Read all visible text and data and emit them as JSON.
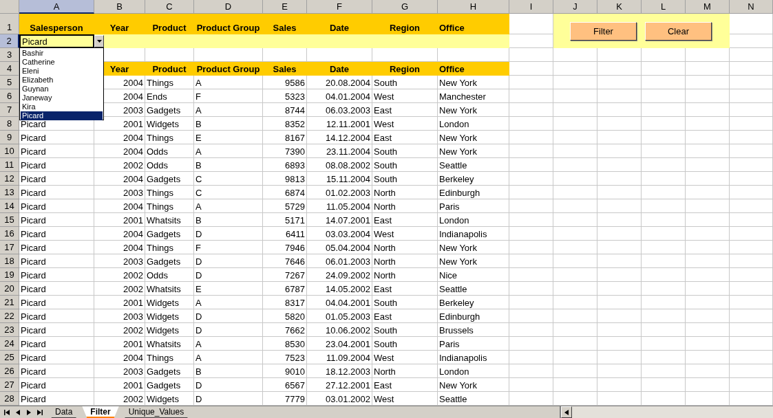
{
  "columns": [
    {
      "label": "A",
      "selected": true
    },
    {
      "label": "B",
      "selected": false
    },
    {
      "label": "C",
      "selected": false
    },
    {
      "label": "D",
      "selected": false
    },
    {
      "label": "E",
      "selected": false
    },
    {
      "label": "F",
      "selected": false
    },
    {
      "label": "G",
      "selected": false
    },
    {
      "label": "H",
      "selected": false
    },
    {
      "label": "I",
      "selected": false
    },
    {
      "label": "J",
      "selected": false
    },
    {
      "label": "K",
      "selected": false
    },
    {
      "label": "L",
      "selected": false
    },
    {
      "label": "M",
      "selected": false
    },
    {
      "label": "N",
      "selected": false
    }
  ],
  "row_numbers": [
    {
      "label": "1",
      "selected": false
    },
    {
      "label": "2",
      "selected": true
    },
    {
      "label": "3",
      "selected": false
    },
    {
      "label": "4",
      "selected": false
    },
    {
      "label": "5",
      "selected": false
    },
    {
      "label": "6",
      "selected": false
    },
    {
      "label": "7",
      "selected": false
    },
    {
      "label": "8",
      "selected": false
    },
    {
      "label": "9",
      "selected": false
    },
    {
      "label": "10",
      "selected": false
    },
    {
      "label": "11",
      "selected": false
    },
    {
      "label": "12",
      "selected": false
    },
    {
      "label": "13",
      "selected": false
    },
    {
      "label": "14",
      "selected": false
    },
    {
      "label": "15",
      "selected": false
    },
    {
      "label": "16",
      "selected": false
    },
    {
      "label": "17",
      "selected": false
    },
    {
      "label": "18",
      "selected": false
    },
    {
      "label": "19",
      "selected": false
    },
    {
      "label": "20",
      "selected": false
    },
    {
      "label": "21",
      "selected": false
    },
    {
      "label": "22",
      "selected": false
    },
    {
      "label": "23",
      "selected": false
    },
    {
      "label": "24",
      "selected": false
    },
    {
      "label": "25",
      "selected": false
    },
    {
      "label": "26",
      "selected": false
    },
    {
      "label": "27",
      "selected": false
    },
    {
      "label": "28",
      "selected": false
    }
  ],
  "criteria_header": [
    "Salesperson",
    "Year",
    "Product",
    "Product Group",
    "Sales",
    "Date",
    "Region",
    "Office"
  ],
  "criteria_value": "Picard",
  "dropdown": [
    {
      "label": "Bashir",
      "selected": false
    },
    {
      "label": "Catherine",
      "selected": false
    },
    {
      "label": "Eleni",
      "selected": false
    },
    {
      "label": "Elizabeth",
      "selected": false
    },
    {
      "label": "Guynan",
      "selected": false
    },
    {
      "label": "Janeway",
      "selected": false
    },
    {
      "label": "Kira",
      "selected": false
    },
    {
      "label": "Picard",
      "selected": true
    }
  ],
  "buttons": [
    "Filter",
    "Clear"
  ],
  "result_header": [
    "Year",
    "Product",
    "Product Group",
    "Sales",
    "Date",
    "Region",
    "Office"
  ],
  "data_rows": [
    {
      "values": [
        "2004",
        "Things",
        "A",
        "9586",
        "20.08.2004",
        "South",
        "New York"
      ]
    },
    {
      "values": [
        "2004",
        "Ends",
        "F",
        "5323",
        "04.01.2004",
        "West",
        "Manchester"
      ]
    },
    {
      "values": [
        "2003",
        "Gadgets",
        "A",
        "8744",
        "06.03.2003",
        "East",
        "New York"
      ]
    },
    {
      "salesperson": "Picard",
      "values": [
        "2001",
        "Widgets",
        "B",
        "8352",
        "12.11.2001",
        "West",
        "London"
      ]
    },
    {
      "salesperson": "Picard",
      "values": [
        "2004",
        "Things",
        "E",
        "8167",
        "14.12.2004",
        "East",
        "New York"
      ]
    },
    {
      "salesperson": "Picard",
      "values": [
        "2004",
        "Odds",
        "A",
        "7390",
        "23.11.2004",
        "South",
        "New York"
      ]
    },
    {
      "salesperson": "Picard",
      "values": [
        "2002",
        "Odds",
        "B",
        "6893",
        "08.08.2002",
        "South",
        "Seattle"
      ]
    },
    {
      "salesperson": "Picard",
      "values": [
        "2004",
        "Gadgets",
        "C",
        "9813",
        "15.11.2004",
        "South",
        "Berkeley"
      ]
    },
    {
      "salesperson": "Picard",
      "values": [
        "2003",
        "Things",
        "C",
        "6874",
        "01.02.2003",
        "North",
        "Edinburgh"
      ]
    },
    {
      "salesperson": "Picard",
      "values": [
        "2004",
        "Things",
        "A",
        "5729",
        "11.05.2004",
        "North",
        "Paris"
      ]
    },
    {
      "salesperson": "Picard",
      "values": [
        "2001",
        "Whatsits",
        "B",
        "5171",
        "14.07.2001",
        "East",
        "London"
      ]
    },
    {
      "salesperson": "Picard",
      "values": [
        "2004",
        "Gadgets",
        "D",
        "6411",
        "03.03.2004",
        "West",
        "Indianapolis"
      ]
    },
    {
      "salesperson": "Picard",
      "values": [
        "2004",
        "Things",
        "F",
        "7946",
        "05.04.2004",
        "North",
        "New York"
      ]
    },
    {
      "salesperson": "Picard",
      "values": [
        "2003",
        "Gadgets",
        "D",
        "7646",
        "06.01.2003",
        "North",
        "New York"
      ]
    },
    {
      "salesperson": "Picard",
      "values": [
        "2002",
        "Odds",
        "D",
        "7267",
        "24.09.2002",
        "North",
        "Nice"
      ]
    },
    {
      "salesperson": "Picard",
      "values": [
        "2002",
        "Whatsits",
        "E",
        "6787",
        "14.05.2002",
        "East",
        "Seattle"
      ]
    },
    {
      "salesperson": "Picard",
      "values": [
        "2001",
        "Widgets",
        "A",
        "8317",
        "04.04.2001",
        "South",
        "Berkeley"
      ]
    },
    {
      "salesperson": "Picard",
      "values": [
        "2003",
        "Widgets",
        "D",
        "5820",
        "01.05.2003",
        "East",
        "Edinburgh"
      ]
    },
    {
      "salesperson": "Picard",
      "values": [
        "2002",
        "Widgets",
        "D",
        "7662",
        "10.06.2002",
        "South",
        "Brussels"
      ]
    },
    {
      "salesperson": "Picard",
      "values": [
        "2001",
        "Whatsits",
        "A",
        "8530",
        "23.04.2001",
        "South",
        "Paris"
      ]
    },
    {
      "salesperson": "Picard",
      "values": [
        "2004",
        "Things",
        "A",
        "7523",
        "11.09.2004",
        "West",
        "Indianapolis"
      ]
    },
    {
      "salesperson": "Picard",
      "values": [
        "2003",
        "Gadgets",
        "B",
        "9010",
        "18.12.2003",
        "North",
        "London"
      ]
    },
    {
      "salesperson": "Picard",
      "values": [
        "2001",
        "Gadgets",
        "D",
        "6567",
        "27.12.2001",
        "East",
        "New York"
      ]
    },
    {
      "salesperson": "Picard",
      "values": [
        "2002",
        "Widgets",
        "D",
        "7779",
        "03.01.2002",
        "West",
        "Seattle"
      ]
    }
  ],
  "sheet_tabs": [
    {
      "label": "Data",
      "selected": false
    },
    {
      "label": "Filter",
      "selected": true
    },
    {
      "label": "Unique_Values",
      "selected": false
    }
  ]
}
